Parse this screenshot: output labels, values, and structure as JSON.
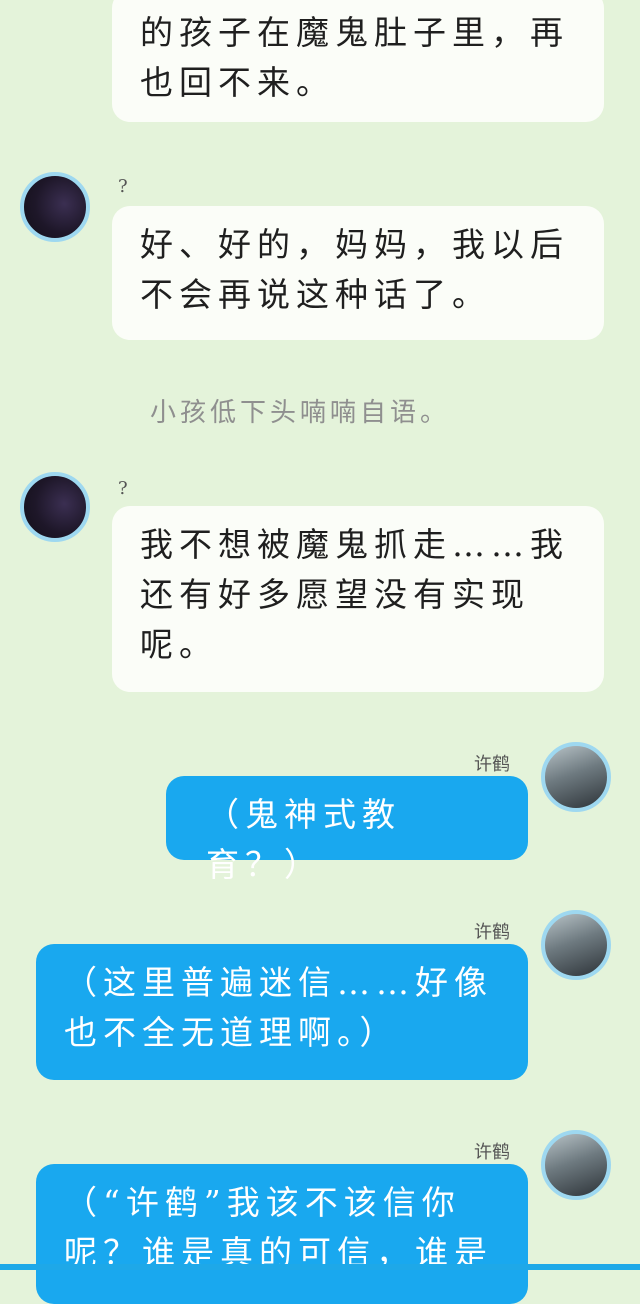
{
  "messages": [
    {
      "side": "left",
      "text": "的孩子在魔鬼肚子里，再\n也回不来。"
    },
    {
      "side": "left",
      "sender": "?",
      "text": "好、好的，妈妈，我以后\n不会再说这种话了。"
    },
    {
      "narration": "小孩低下头喃喃自语。"
    },
    {
      "side": "left",
      "sender": "?",
      "text": "我不想被魔鬼抓走……我\n还有好多愿望没有实现\n呢。"
    },
    {
      "side": "right",
      "sender": "许鹤",
      "text": "（鬼神式教育？）"
    },
    {
      "side": "right",
      "sender": "许鹤",
      "text": "（这里普遍迷信……好像\n也不全无道理啊。）"
    },
    {
      "side": "right",
      "sender": "许鹤",
      "text": "（“许鹤”我该不该信你\n呢？谁是真的可信，谁是"
    }
  ],
  "colors": {
    "background": "#e4f3da",
    "left_bubble": "#fbfdf8",
    "right_bubble": "#19a8ef",
    "avatar_ring": "#9ed8f0"
  },
  "icons": {
    "unknown_avatar": "dark-silhouette-avatar",
    "xuhe_avatar": "anime-boy-avatar"
  }
}
